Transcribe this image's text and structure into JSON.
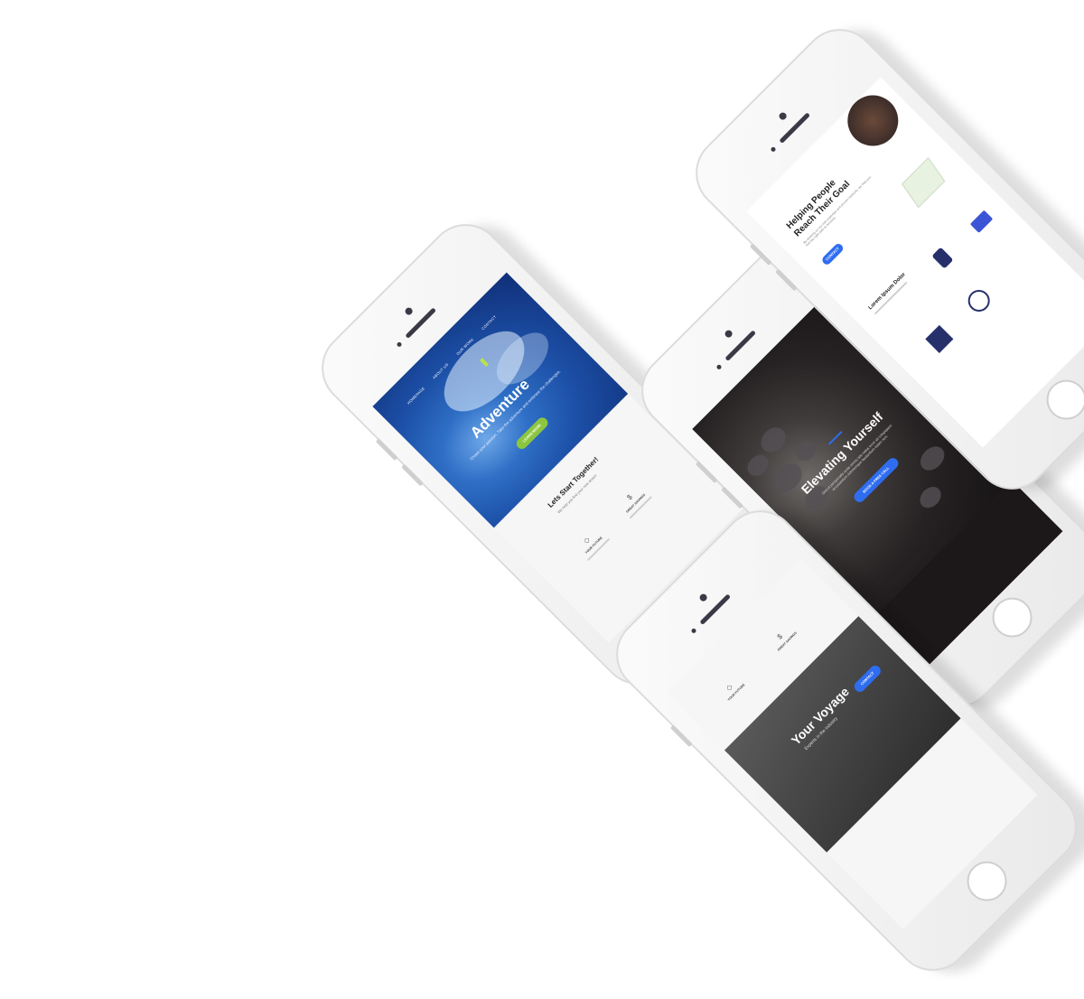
{
  "phone1": {
    "nav": [
      "HOMEPAGE",
      "ABOUT US",
      "OUR WORK",
      "CONTACT"
    ],
    "hero_title": "Adventure",
    "hero_sub": "Chase your passion. Take the adventure and embrace the challenges.",
    "cta": "LEARN MORE",
    "section_title": "Lets Start Together!",
    "section_sub": "We help you find your new dream",
    "features": [
      {
        "icon": "diamond-icon",
        "title": "YOUR FUTURE"
      },
      {
        "icon": "dollar-icon",
        "title": "GREAT SAVINGS"
      }
    ]
  },
  "phone2": {
    "hero_title": "Elevating Yourself",
    "hero_sub": "Sed ut perspiciatis unde omnis iste natus error sit voluptatem accusantium doloremque laudantium totam rem.",
    "cta": "BOOK A FREE CALL"
  },
  "phone3": {
    "hero_title_1": "Helping People",
    "hero_title_2": "Reach Their Goal",
    "hero_sub": "By drawing on our own expertise and proven methods, we help you find the right path to success.",
    "cta": "CONTACT",
    "section_title": "Lorem Ipsum Dolor"
  },
  "phone4": {
    "features": [
      {
        "icon": "diamond-icon",
        "title": "YOUR FUTURE"
      },
      {
        "icon": "dollar-icon",
        "title": "GREAT SAVINGS"
      }
    ],
    "hero_title": "Your Voyage",
    "hero_sub": "Experts in the industry",
    "cta": "CONTACT"
  },
  "colors": {
    "accent_blue": "#2f6df0",
    "accent_green": "#8cc63f",
    "phone_body": "#f2f2f2"
  }
}
